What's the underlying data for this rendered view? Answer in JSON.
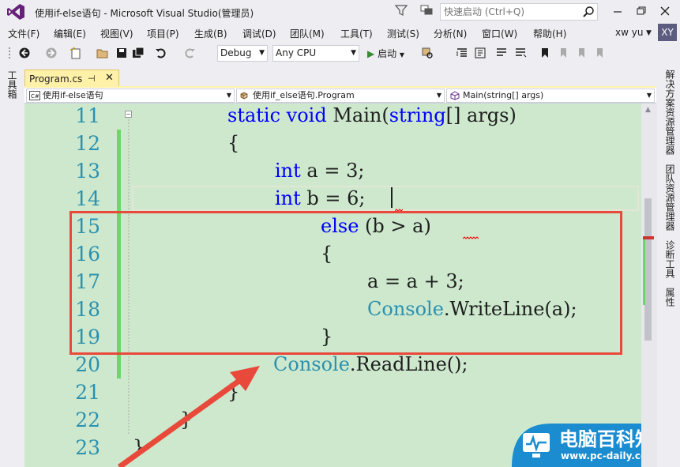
{
  "window": {
    "title": "使用if-else语句 - Microsoft Visual Studio(管理员)",
    "quick_launch_placeholder": "快速启动 (Ctrl+Q)",
    "user_name": "xw yu",
    "avatar_initials": "XY"
  },
  "menu": [
    "文件(F)",
    "编辑(E)",
    "视图(V)",
    "项目(P)",
    "生成(B)",
    "调试(D)",
    "团队(M)",
    "工具(T)",
    "测试(S)",
    "分析(N)",
    "窗口(W)",
    "帮助(H)"
  ],
  "toolbar": {
    "config": "Debug",
    "platform": "Any CPU",
    "start_label": "启动"
  },
  "left_panel": {
    "toolbox_label": "工具箱"
  },
  "right_panel": {
    "solution_explorer": "解决方案资源管理器",
    "team_explorer": "团队资源管理器",
    "diagnostics": "诊断工具",
    "properties": "属性"
  },
  "editor": {
    "tab_name": "Program.cs",
    "tab_pin": "⊣",
    "tab_close": "✕",
    "nav_project": "使用if-else语句",
    "nav_class": "使用if_else语句.Program",
    "nav_member": "Main(string[] args)",
    "lines": [
      {
        "num": "11",
        "text": "static void Main(string[] args)"
      },
      {
        "num": "12",
        "text": "{"
      },
      {
        "num": "13",
        "text": "int a = 3;"
      },
      {
        "num": "14",
        "text": "int b = 6;"
      },
      {
        "num": "15",
        "text": "else (b > a)"
      },
      {
        "num": "16",
        "text": "{"
      },
      {
        "num": "17",
        "text": "a = a + 3;"
      },
      {
        "num": "18",
        "text": "Console.WriteLine(a);"
      },
      {
        "num": "19",
        "text": "}"
      },
      {
        "num": "20",
        "text": "Console.ReadLine();"
      },
      {
        "num": "21",
        "text": "}"
      },
      {
        "num": "22",
        "text": "}"
      },
      {
        "num": "23",
        "text": "}"
      }
    ]
  },
  "watermark": {
    "brand": "电脑百科知识",
    "url": "www.pc-daily.com"
  },
  "colors": {
    "editor_bg": "#cde8cd",
    "keyword": "#0000ff",
    "type": "#2b91af",
    "highlight_box": "#e8493a",
    "arrow": "#e8493a"
  }
}
